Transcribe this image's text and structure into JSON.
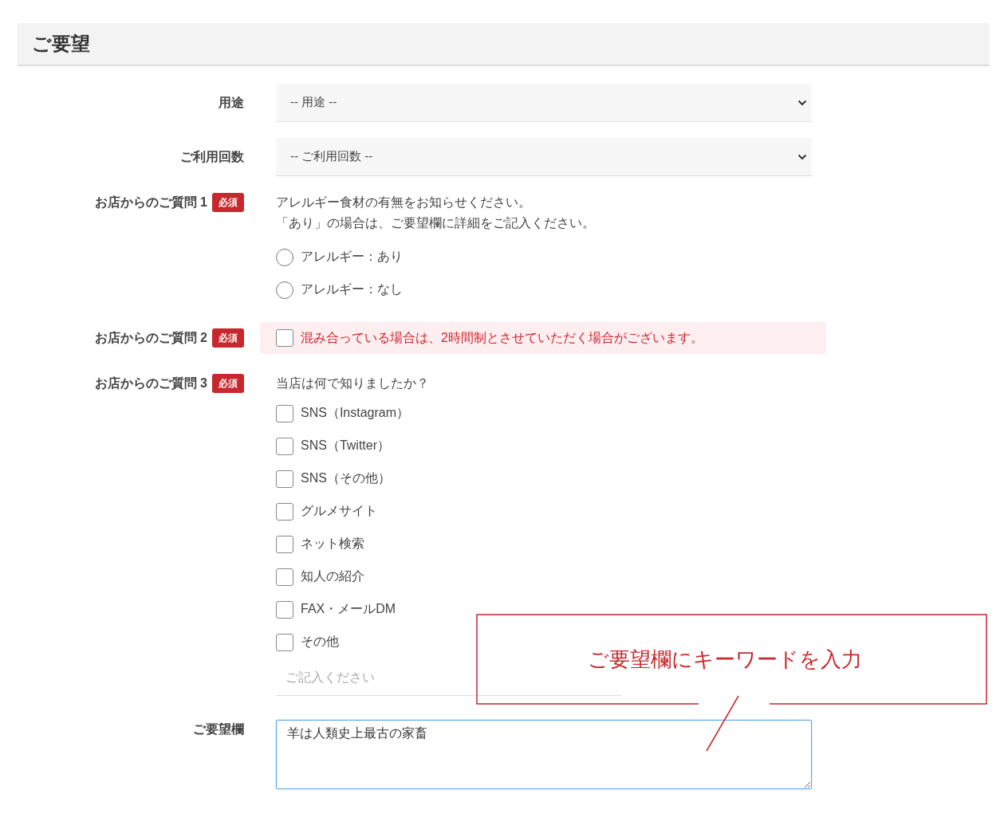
{
  "section": {
    "title": "ご要望"
  },
  "fields": [
    {
      "kind": "select",
      "label": "用途",
      "value": "-- 用途 --"
    },
    {
      "kind": "select",
      "label": "ご利用回数",
      "value": "-- ご利用回数 --"
    },
    {
      "kind": "radio",
      "label": "お店からのご質問 1",
      "required": true,
      "badge": "必須",
      "prompt": [
        "アレルギー食材の有無をお知らせください。",
        "「あり」の場合は、ご要望欄に詳細をご記入ください。"
      ],
      "options": [
        {
          "label": "アレルギー：あり",
          "selected": false
        },
        {
          "label": "アレルギー：なし",
          "selected": false
        }
      ]
    },
    {
      "kind": "notice",
      "label": "お店からのご質問 2",
      "required": true,
      "badge": "必須",
      "options": [
        {
          "label": "混み合っている場合は、2時間制とさせていただく場合がございます。",
          "checked": false
        }
      ]
    },
    {
      "kind": "checkboxes",
      "label": "お店からのご質問 3",
      "required": true,
      "badge": "必須",
      "prompt": [
        "当店は何で知りましたか？"
      ],
      "options": [
        {
          "label": "SNS（Instagram）",
          "checked": false
        },
        {
          "label": "SNS（Twitter）",
          "checked": false
        },
        {
          "label": "SNS（その他）",
          "checked": false
        },
        {
          "label": "グルメサイト",
          "checked": false
        },
        {
          "label": "ネット検索",
          "checked": false
        },
        {
          "label": "知人の紹介",
          "checked": false
        },
        {
          "label": "FAX・メールDM",
          "checked": false
        },
        {
          "label": "その他",
          "checked": false
        }
      ],
      "other_field": {
        "placeholder": "ご記入ください"
      }
    },
    {
      "kind": "textarea",
      "label": "ご要望欄",
      "value": "羊は人類史上最古の家畜",
      "focused": true
    }
  ],
  "callout": {
    "text": "ご要望欄にキーワードを入力"
  }
}
